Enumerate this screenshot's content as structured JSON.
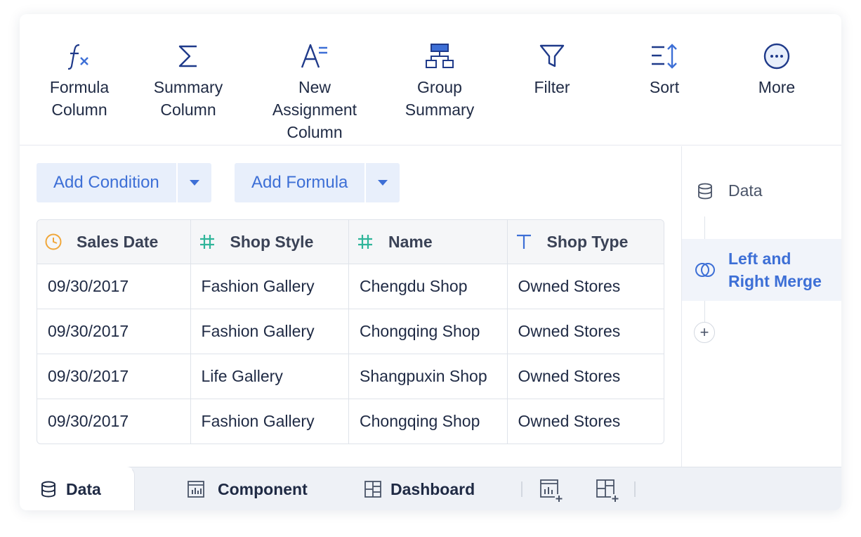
{
  "toolbar": {
    "items": [
      {
        "id": "formula-column",
        "line1": "Formula",
        "line2": "Column",
        "icon": "fx-icon"
      },
      {
        "id": "summary-column",
        "line1": "Summary",
        "line2": "Column",
        "icon": "sigma-icon"
      },
      {
        "id": "new-assignment-column",
        "line1": "New Assignment",
        "line2": "Column",
        "icon": "text-assign-icon"
      },
      {
        "id": "group-summary",
        "line1": "Group",
        "line2": "Summary",
        "icon": "hierarchy-icon"
      },
      {
        "id": "filter",
        "line1": "Filter",
        "line2": "",
        "icon": "funnel-icon"
      },
      {
        "id": "sort",
        "line1": "Sort",
        "line2": "",
        "icon": "sort-icon"
      },
      {
        "id": "more",
        "line1": "More",
        "line2": "",
        "icon": "ellipsis-circle-icon"
      }
    ]
  },
  "actions": {
    "add_condition": "Add Condition",
    "add_formula": "Add Formula"
  },
  "table": {
    "columns": [
      {
        "label": "Sales Date",
        "icon": "clock-icon"
      },
      {
        "label": "Shop Style",
        "icon": "hash-icon"
      },
      {
        "label": "Name",
        "icon": "hash-icon"
      },
      {
        "label": "Shop Type",
        "icon": "text-type-icon"
      }
    ],
    "rows": [
      [
        "09/30/2017",
        "Fashion Gallery",
        "Chengdu Shop",
        "Owned Stores"
      ],
      [
        "09/30/2017",
        "Fashion Gallery",
        "Chongqing Shop",
        "Owned Stores"
      ],
      [
        "09/30/2017",
        "Life Gallery",
        "Shangpuxin Shop",
        "Owned Stores"
      ],
      [
        "09/30/2017",
        "Fashion Gallery",
        "Chongqing Shop",
        "Owned Stores"
      ]
    ]
  },
  "steps": {
    "data": "Data",
    "merge_line1": "Left and",
    "merge_line2": "Right Merge",
    "add": "+"
  },
  "tabs": {
    "data": "Data",
    "component": "Component",
    "dashboard": "Dashboard"
  },
  "colors": {
    "accent": "#3d6fd6",
    "icon_dark": "#1f3a8a",
    "clock": "#f0a73a",
    "hash": "#2fb59a"
  }
}
